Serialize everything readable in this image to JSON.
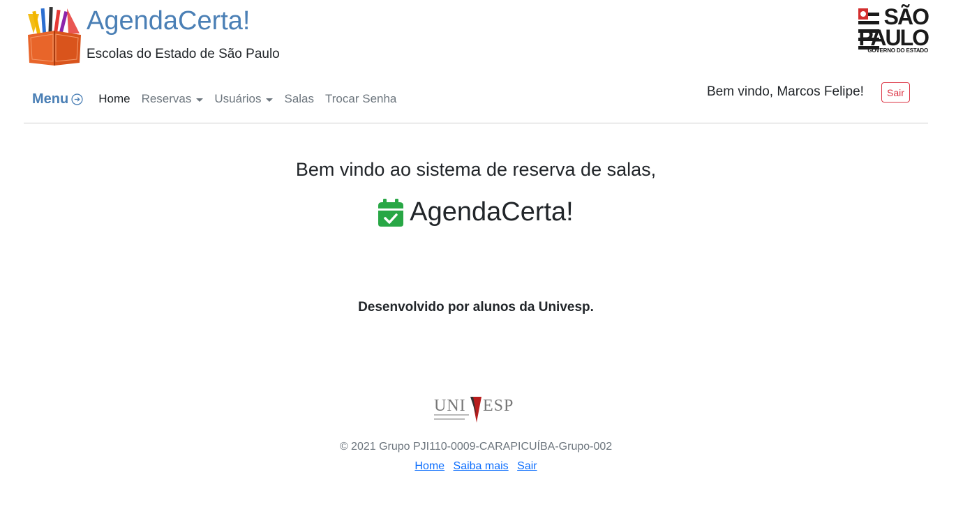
{
  "brand": {
    "title": "AgendaCerta!",
    "subtitle": "Escolas do Estado de São Paulo"
  },
  "gov_logo": {
    "line1": "SÃO",
    "line2": "PAULO",
    "line3": "GOVERNO DO ESTADO"
  },
  "nav": {
    "menu_label": "Menu",
    "items": [
      {
        "label": "Home",
        "active": true,
        "dropdown": false
      },
      {
        "label": "Reservas",
        "active": false,
        "dropdown": true
      },
      {
        "label": "Usuários",
        "active": false,
        "dropdown": true
      },
      {
        "label": "Salas",
        "active": false,
        "dropdown": false
      },
      {
        "label": "Trocar Senha",
        "active": false,
        "dropdown": false
      }
    ]
  },
  "user": {
    "welcome": "Bem vindo, Marcos Felipe!",
    "logout_label": "Sair"
  },
  "main": {
    "headline": "Bem vindo ao sistema de reserva de salas,",
    "app_title": "AgendaCerta!",
    "credits": "Desenvolvido por alunos da Univesp."
  },
  "footer": {
    "logo_text_left": "UNI",
    "logo_text_right": "ESP",
    "copyright": "© 2021 Grupo PJI110-0009-CARAPICUÍBA-Grupo-002",
    "links": [
      "Home",
      "Saiba mais",
      "Sair"
    ]
  },
  "colors": {
    "brand_blue": "#4a7fb5",
    "success_green": "#28a745",
    "danger_red": "#dc3545",
    "link_blue": "#0d6efd"
  },
  "icons": {
    "logo": "book-pencils-icon",
    "menu": "arrow-right-circle-icon",
    "calendar": "calendar-check-icon"
  }
}
